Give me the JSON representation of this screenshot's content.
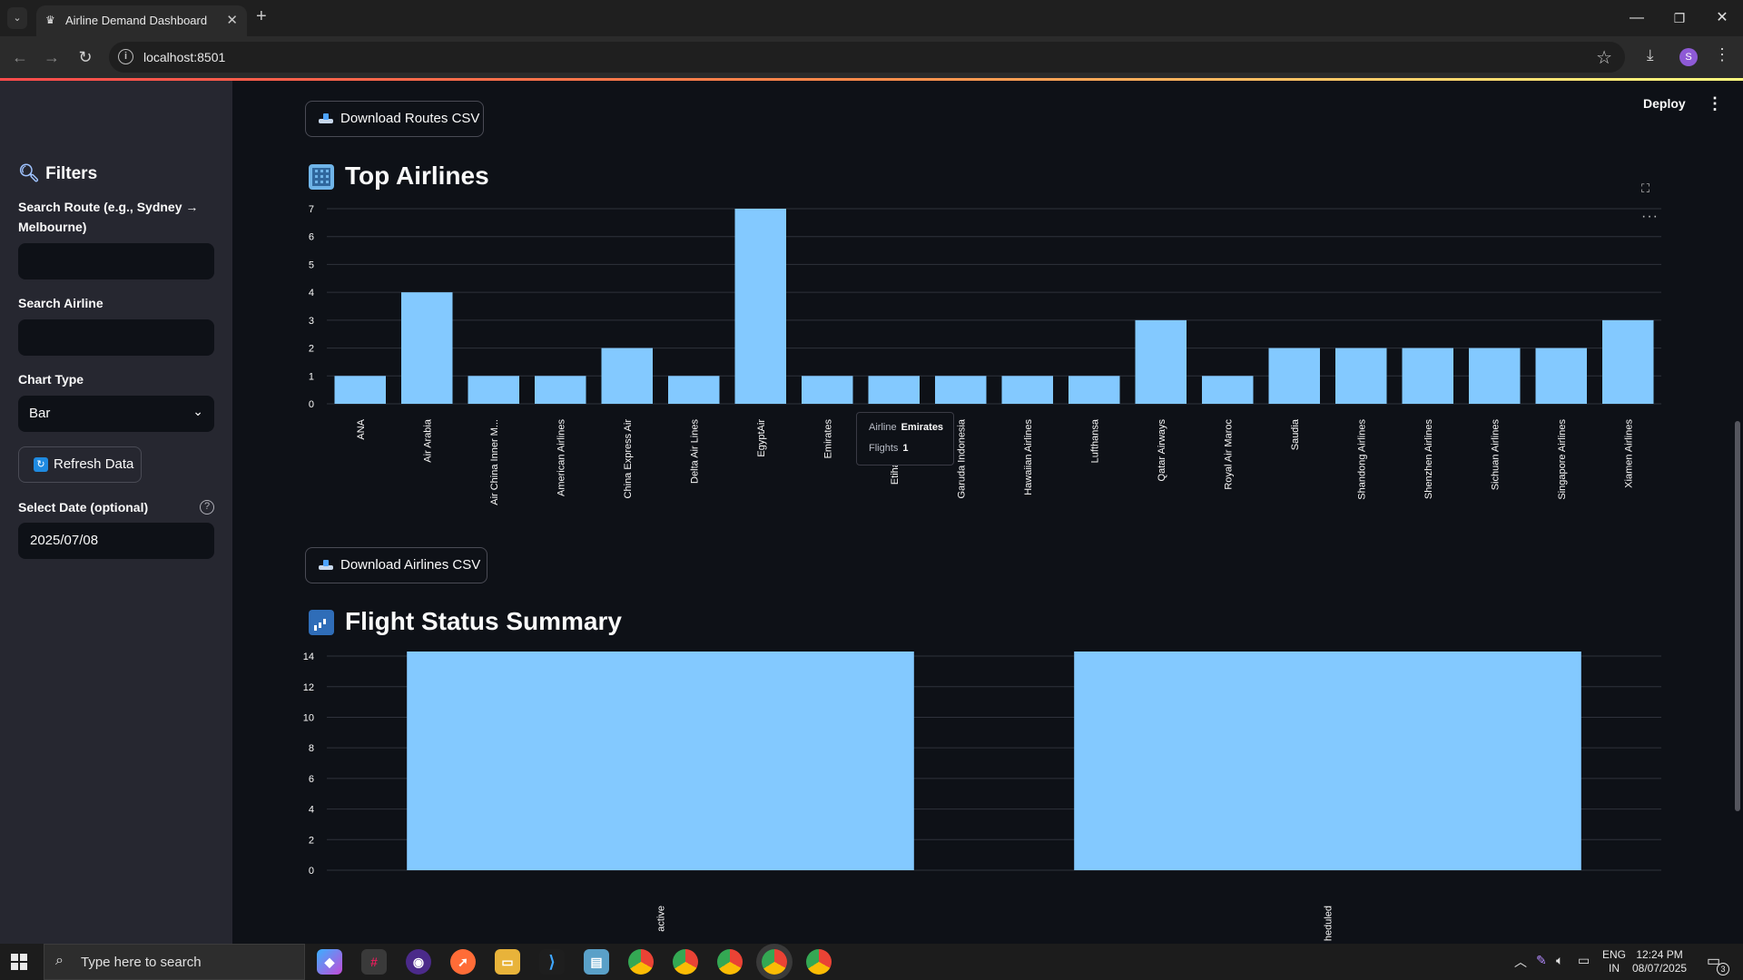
{
  "browser": {
    "tab_title": "Airline Demand Dashboard",
    "url": "localhost:8501",
    "profile_initial": "S"
  },
  "sidebar": {
    "heading": "Filters",
    "search_route_label": "Search Route (e.g., Sydney → Melbourne)",
    "search_route_value": "",
    "search_airline_label": "Search Airline",
    "search_airline_value": "",
    "chart_type_label": "Chart Type",
    "chart_type_value": "Bar",
    "refresh_label": "Refresh Data",
    "date_label": "Select Date (optional)",
    "date_value": "2025/07/08"
  },
  "header": {
    "deploy_label": "Deploy"
  },
  "main": {
    "download_routes_label": "Download Routes CSV",
    "top_airlines_title": "Top Airlines",
    "download_airlines_label": "Download Airlines CSV",
    "status_title": "Flight Status Summary"
  },
  "tooltip": {
    "airline_key": "Airline",
    "airline_value": "Emirates",
    "flights_key": "Flights",
    "flights_value": "1"
  },
  "chart_data": [
    {
      "type": "bar",
      "title": "Top Airlines",
      "categories": [
        "ANA",
        "Air Arabia",
        "Air China Inner M...",
        "American Airlines",
        "China Express Air",
        "Delta Air Lines",
        "EgyptAir",
        "Emirates",
        "Etihad Airways",
        "Garuda Indonesia",
        "Hawaiian Airlines",
        "Lufthansa",
        "Qatar Airways",
        "Royal Air Maroc",
        "Saudia",
        "Shandong Airlines",
        "Shenzhen Airlines",
        "Sichuan Airlines",
        "Singapore Airlines",
        "Xiamen Airlines"
      ],
      "values": [
        1,
        4,
        1,
        1,
        2,
        1,
        7,
        1,
        1,
        1,
        1,
        1,
        3,
        1,
        2,
        2,
        2,
        2,
        2,
        3
      ],
      "yticks": [
        0,
        1,
        2,
        3,
        4,
        5,
        6,
        7
      ],
      "ylim": [
        0,
        7
      ],
      "grid": true,
      "bar_color": "#83c9ff"
    },
    {
      "type": "bar",
      "title": "Flight Status Summary",
      "categories": [
        "active",
        "scheduled"
      ],
      "tick_labels": [
        "active",
        "heduled"
      ],
      "values": [
        14.3,
        14.3
      ],
      "yticks": [
        0,
        2,
        4,
        6,
        8,
        10,
        12,
        14
      ],
      "ylim": [
        0,
        14.3
      ],
      "grid": true,
      "bar_color": "#83c9ff"
    }
  ],
  "taskbar": {
    "search_placeholder": "Type here to search",
    "lang_line1": "ENG",
    "lang_line2": "IN",
    "time": "12:24 PM",
    "date": "08/07/2025",
    "notification_count": "3"
  }
}
